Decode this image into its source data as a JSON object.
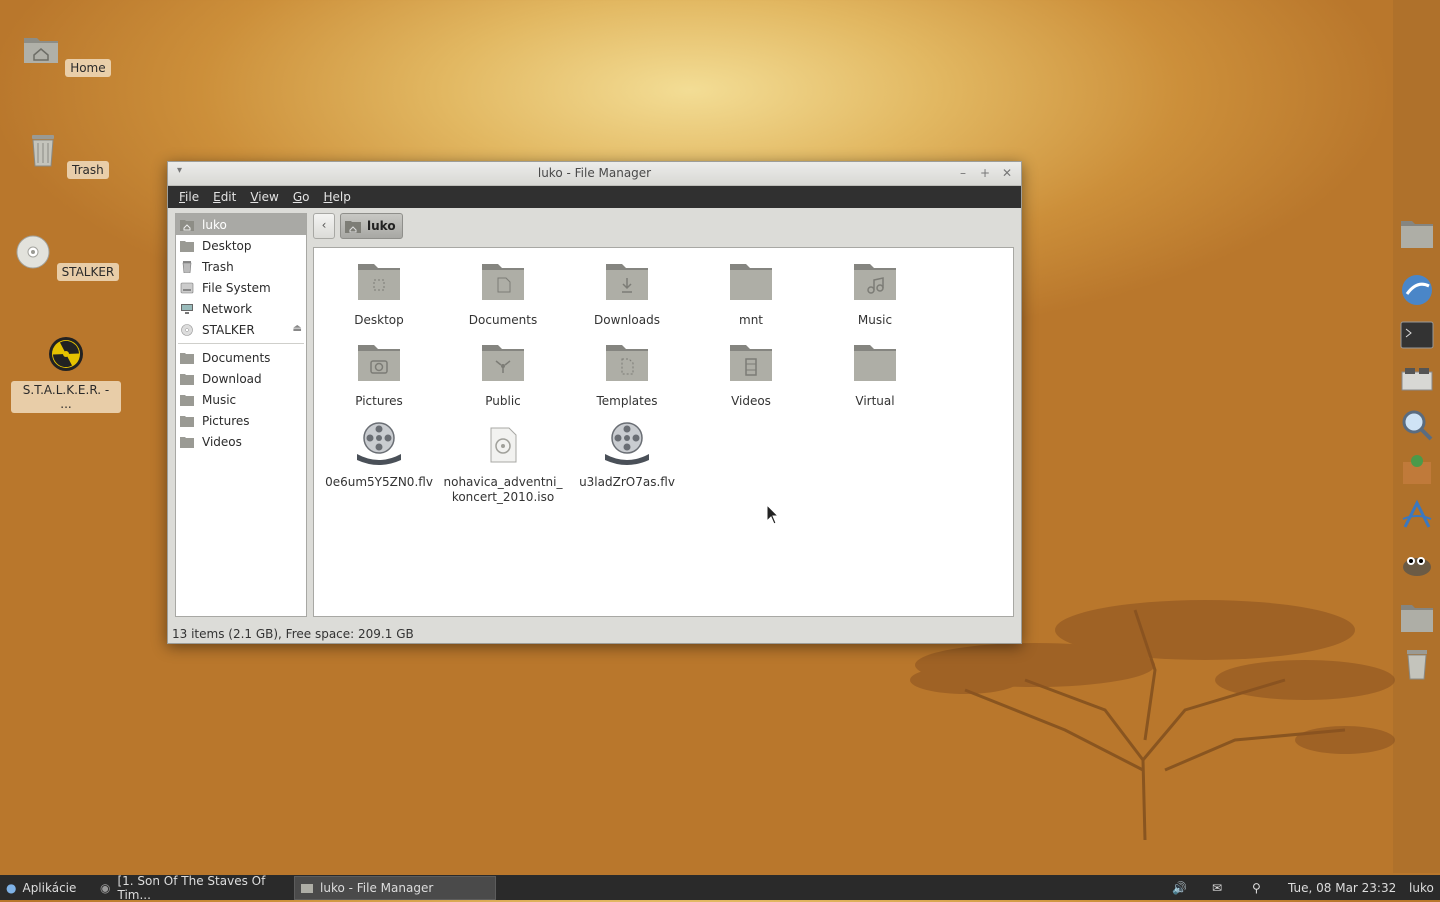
{
  "desktop": {
    "icons": [
      {
        "label": "Home"
      },
      {
        "label": "Trash"
      },
      {
        "label": "STALKER"
      },
      {
        "label": "S.T.A.L.K.E.R. - ..."
      }
    ]
  },
  "window": {
    "title": "luko - File Manager",
    "menu": [
      "File",
      "Edit",
      "View",
      "Go",
      "Help"
    ],
    "sidebar": {
      "places": [
        "luko",
        "Desktop",
        "Trash",
        "File System",
        "Network",
        "STALKER"
      ],
      "bookmarks": [
        "Documents",
        "Download",
        "Music",
        "Pictures",
        "Videos"
      ]
    },
    "path": {
      "current": "luko"
    },
    "files": [
      {
        "name": "Desktop",
        "icon": "desktop-folder-icon"
      },
      {
        "name": "Documents",
        "icon": "documents-folder-icon"
      },
      {
        "name": "Downloads",
        "icon": "downloads-folder-icon"
      },
      {
        "name": "mnt",
        "icon": "folder-icon"
      },
      {
        "name": "Music",
        "icon": "music-folder-icon"
      },
      {
        "name": "Pictures",
        "icon": "pictures-folder-icon"
      },
      {
        "name": "Public",
        "icon": "public-folder-icon"
      },
      {
        "name": "Templates",
        "icon": "templates-folder-icon"
      },
      {
        "name": "Videos",
        "icon": "videos-folder-icon"
      },
      {
        "name": "Virtual",
        "icon": "folder-icon"
      },
      {
        "name": "0e6um5Y5ZN0.flv",
        "icon": "film-reel-icon"
      },
      {
        "name": "nohavica_adventni_koncert_2010.iso",
        "icon": "disc-image-icon"
      },
      {
        "name": "u3ladZrO7as.flv",
        "icon": "film-reel-icon"
      }
    ],
    "status": "13 items (2.1 GB), Free space: 209.1 GB"
  },
  "taskbar": {
    "menu_label": "Aplikácie",
    "tasks": [
      {
        "label": "[1. Son Of The Staves Of Tim..."
      },
      {
        "label": "luko - File Manager"
      }
    ],
    "clock": "Tue, 08 Mar 23:32",
    "user": "luko"
  }
}
